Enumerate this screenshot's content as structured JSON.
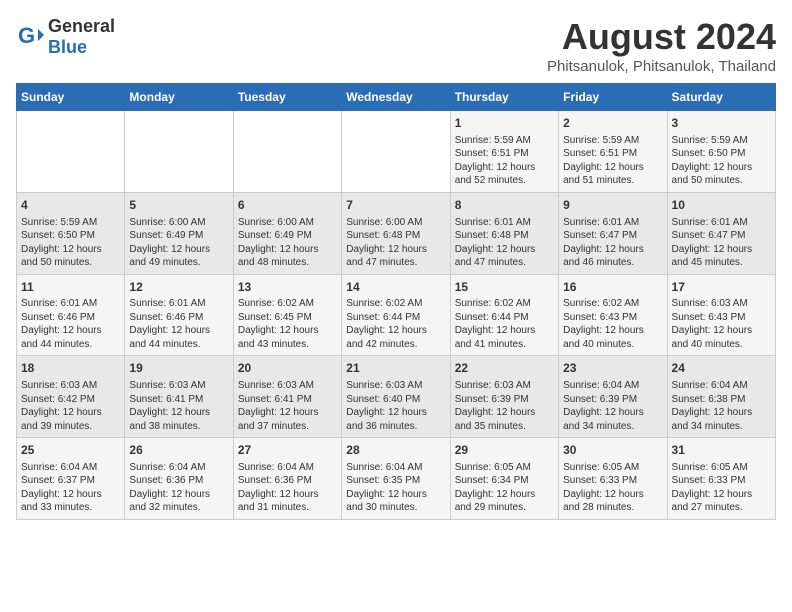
{
  "header": {
    "logo_general": "General",
    "logo_blue": "Blue",
    "title": "August 2024",
    "subtitle": "Phitsanulok, Phitsanulok, Thailand"
  },
  "columns": [
    "Sunday",
    "Monday",
    "Tuesday",
    "Wednesday",
    "Thursday",
    "Friday",
    "Saturday"
  ],
  "rows": [
    [
      {
        "day": "",
        "content": ""
      },
      {
        "day": "",
        "content": ""
      },
      {
        "day": "",
        "content": ""
      },
      {
        "day": "",
        "content": ""
      },
      {
        "day": "1",
        "content": "Sunrise: 5:59 AM\nSunset: 6:51 PM\nDaylight: 12 hours\nand 52 minutes."
      },
      {
        "day": "2",
        "content": "Sunrise: 5:59 AM\nSunset: 6:51 PM\nDaylight: 12 hours\nand 51 minutes."
      },
      {
        "day": "3",
        "content": "Sunrise: 5:59 AM\nSunset: 6:50 PM\nDaylight: 12 hours\nand 50 minutes."
      }
    ],
    [
      {
        "day": "4",
        "content": "Sunrise: 5:59 AM\nSunset: 6:50 PM\nDaylight: 12 hours\nand 50 minutes."
      },
      {
        "day": "5",
        "content": "Sunrise: 6:00 AM\nSunset: 6:49 PM\nDaylight: 12 hours\nand 49 minutes."
      },
      {
        "day": "6",
        "content": "Sunrise: 6:00 AM\nSunset: 6:49 PM\nDaylight: 12 hours\nand 48 minutes."
      },
      {
        "day": "7",
        "content": "Sunrise: 6:00 AM\nSunset: 6:48 PM\nDaylight: 12 hours\nand 47 minutes."
      },
      {
        "day": "8",
        "content": "Sunrise: 6:01 AM\nSunset: 6:48 PM\nDaylight: 12 hours\nand 47 minutes."
      },
      {
        "day": "9",
        "content": "Sunrise: 6:01 AM\nSunset: 6:47 PM\nDaylight: 12 hours\nand 46 minutes."
      },
      {
        "day": "10",
        "content": "Sunrise: 6:01 AM\nSunset: 6:47 PM\nDaylight: 12 hours\nand 45 minutes."
      }
    ],
    [
      {
        "day": "11",
        "content": "Sunrise: 6:01 AM\nSunset: 6:46 PM\nDaylight: 12 hours\nand 44 minutes."
      },
      {
        "day": "12",
        "content": "Sunrise: 6:01 AM\nSunset: 6:46 PM\nDaylight: 12 hours\nand 44 minutes."
      },
      {
        "day": "13",
        "content": "Sunrise: 6:02 AM\nSunset: 6:45 PM\nDaylight: 12 hours\nand 43 minutes."
      },
      {
        "day": "14",
        "content": "Sunrise: 6:02 AM\nSunset: 6:44 PM\nDaylight: 12 hours\nand 42 minutes."
      },
      {
        "day": "15",
        "content": "Sunrise: 6:02 AM\nSunset: 6:44 PM\nDaylight: 12 hours\nand 41 minutes."
      },
      {
        "day": "16",
        "content": "Sunrise: 6:02 AM\nSunset: 6:43 PM\nDaylight: 12 hours\nand 40 minutes."
      },
      {
        "day": "17",
        "content": "Sunrise: 6:03 AM\nSunset: 6:43 PM\nDaylight: 12 hours\nand 40 minutes."
      }
    ],
    [
      {
        "day": "18",
        "content": "Sunrise: 6:03 AM\nSunset: 6:42 PM\nDaylight: 12 hours\nand 39 minutes."
      },
      {
        "day": "19",
        "content": "Sunrise: 6:03 AM\nSunset: 6:41 PM\nDaylight: 12 hours\nand 38 minutes."
      },
      {
        "day": "20",
        "content": "Sunrise: 6:03 AM\nSunset: 6:41 PM\nDaylight: 12 hours\nand 37 minutes."
      },
      {
        "day": "21",
        "content": "Sunrise: 6:03 AM\nSunset: 6:40 PM\nDaylight: 12 hours\nand 36 minutes."
      },
      {
        "day": "22",
        "content": "Sunrise: 6:03 AM\nSunset: 6:39 PM\nDaylight: 12 hours\nand 35 minutes."
      },
      {
        "day": "23",
        "content": "Sunrise: 6:04 AM\nSunset: 6:39 PM\nDaylight: 12 hours\nand 34 minutes."
      },
      {
        "day": "24",
        "content": "Sunrise: 6:04 AM\nSunset: 6:38 PM\nDaylight: 12 hours\nand 34 minutes."
      }
    ],
    [
      {
        "day": "25",
        "content": "Sunrise: 6:04 AM\nSunset: 6:37 PM\nDaylight: 12 hours\nand 33 minutes."
      },
      {
        "day": "26",
        "content": "Sunrise: 6:04 AM\nSunset: 6:36 PM\nDaylight: 12 hours\nand 32 minutes."
      },
      {
        "day": "27",
        "content": "Sunrise: 6:04 AM\nSunset: 6:36 PM\nDaylight: 12 hours\nand 31 minutes."
      },
      {
        "day": "28",
        "content": "Sunrise: 6:04 AM\nSunset: 6:35 PM\nDaylight: 12 hours\nand 30 minutes."
      },
      {
        "day": "29",
        "content": "Sunrise: 6:05 AM\nSunset: 6:34 PM\nDaylight: 12 hours\nand 29 minutes."
      },
      {
        "day": "30",
        "content": "Sunrise: 6:05 AM\nSunset: 6:33 PM\nDaylight: 12 hours\nand 28 minutes."
      },
      {
        "day": "31",
        "content": "Sunrise: 6:05 AM\nSunset: 6:33 PM\nDaylight: 12 hours\nand 27 minutes."
      }
    ]
  ]
}
